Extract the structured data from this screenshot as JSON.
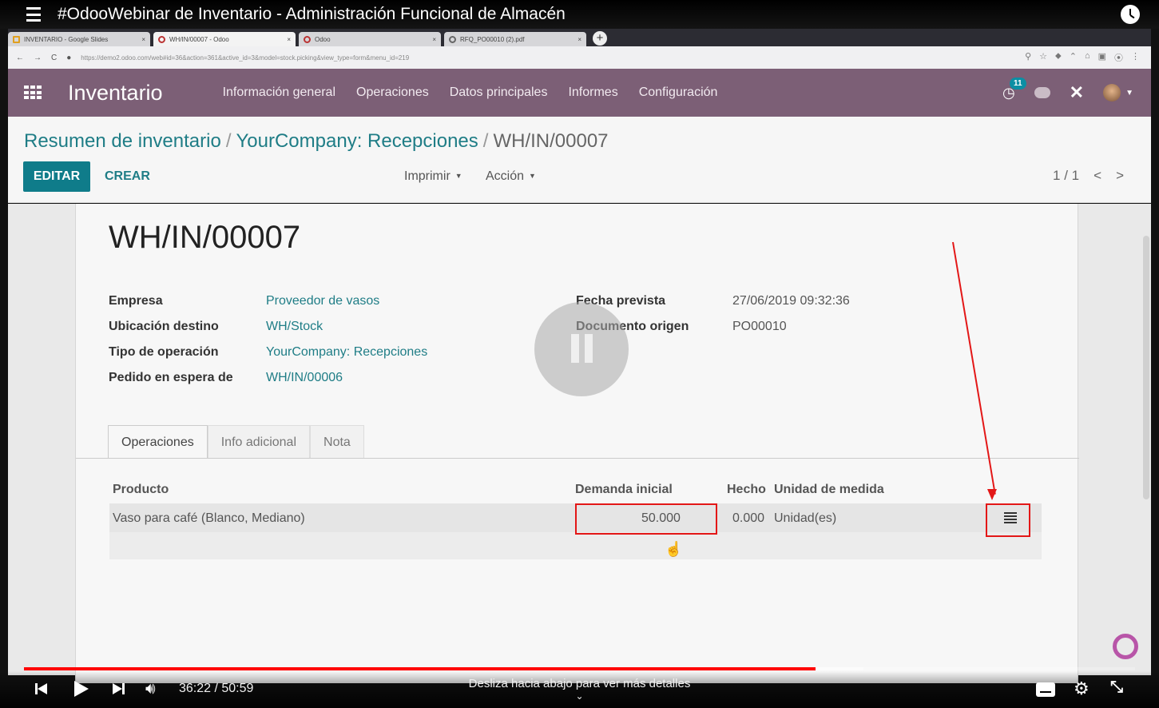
{
  "video": {
    "title": "#OdooWebinar de Inventario - Administración Funcional de Almacén",
    "time": "36:22 / 50:59",
    "swipe_hint": "Desliza hacia abajo para ver más detalles",
    "progress_fraction": 0.7127,
    "buffered_fraction": 0.7557,
    "progress_color": "#ff0000"
  },
  "browser": {
    "tabs": [
      {
        "label": "INVENTARIO - Google Slides",
        "close": "×"
      },
      {
        "label": "WH/IN/00007 - Odoo",
        "close": "×"
      },
      {
        "label": "Odoo",
        "close": "×"
      },
      {
        "label": "RFQ_PO00010 (2).pdf",
        "close": "×"
      }
    ],
    "new_tab": "+",
    "url": "https://demo2.odoo.com/web#id=36&action=361&active_id=3&model=stock.picking&view_type=form&menu_id=219"
  },
  "odoo": {
    "accent_color": "#7c5f76",
    "app_name": "Inventario",
    "menu": [
      "Información general",
      "Operaciones",
      "Datos principales",
      "Informes",
      "Configuración"
    ],
    "activity_count": "11",
    "breadcrumb": {
      "items": [
        "Resumen de inventario",
        "YourCompany: Recepciones"
      ],
      "separator": "/",
      "current": "WH/IN/00007"
    },
    "buttons": {
      "edit": "EDITAR",
      "create": "CREAR"
    },
    "dropdowns": {
      "print": "Imprimir",
      "action": "Acción"
    },
    "pager": {
      "value": "1 / 1",
      "prev": "<",
      "next": ">"
    },
    "record": {
      "title": "WH/IN/00007",
      "fields_left": [
        {
          "label": "Empresa",
          "value": "Proveedor de vasos"
        },
        {
          "label": "Ubicación destino",
          "value": "WH/Stock"
        },
        {
          "label": "Tipo de operación",
          "value": "YourCompany: Recepciones"
        },
        {
          "label": "Pedido en espera de",
          "value": "WH/IN/00006"
        }
      ],
      "fields_right": [
        {
          "label": "Fecha prevista",
          "value": "27/06/2019 09:32:36"
        },
        {
          "label": "Documento origen",
          "value": "PO00010"
        }
      ]
    },
    "notebook_tabs": [
      "Operaciones",
      "Info adicional",
      "Nota"
    ],
    "operations": {
      "columns": [
        "Producto",
        "Demanda inicial",
        "Hecho",
        "Unidad de medida"
      ],
      "rows": [
        {
          "product": "Vaso para café (Blanco, Mediano)",
          "demand": "50.000",
          "done": "0.000",
          "uom": "Unidad(es)"
        }
      ]
    }
  }
}
